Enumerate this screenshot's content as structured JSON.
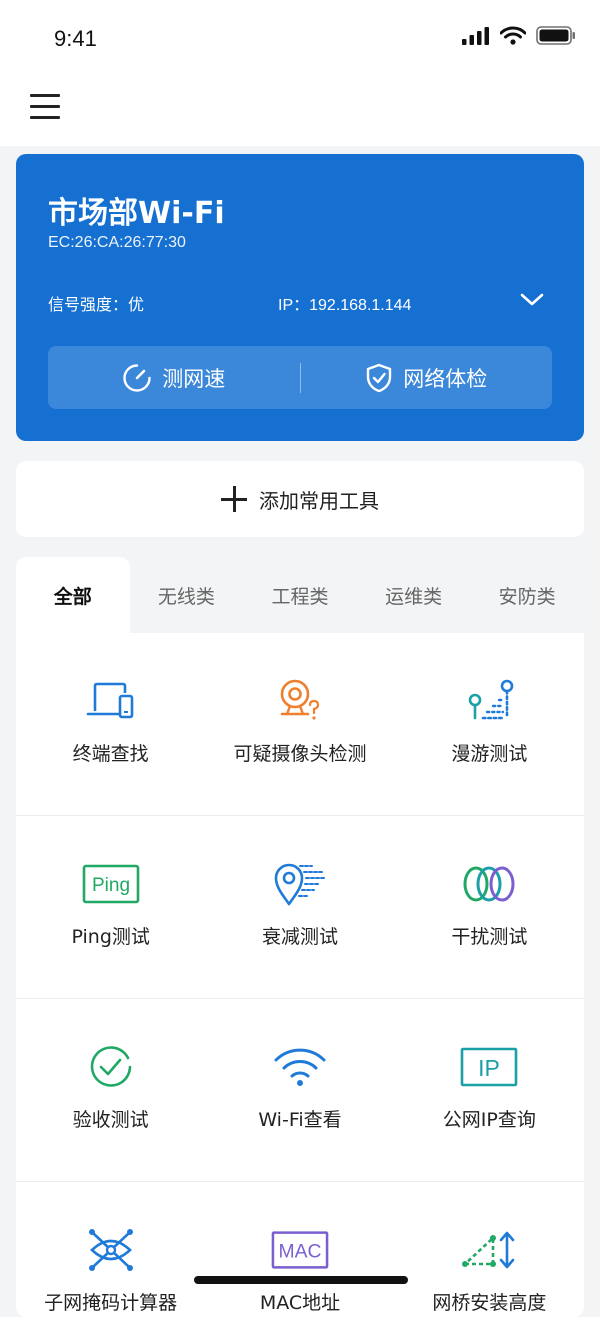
{
  "status_bar": {
    "time": "9:41"
  },
  "wifi": {
    "ssid": "市场部Wi-Fi",
    "mac": "EC:26:CA:26:77:30",
    "signal": "信号强度：优",
    "ip": "IP：192.168.1.144",
    "speed_test_label": "测网速",
    "network_check_label": "网络体检"
  },
  "add_tool_label": "添加常用工具",
  "tabs": [
    "全部",
    "无线类",
    "工程类",
    "运维类",
    "安防类"
  ],
  "tools": [
    {
      "label": "终端查找",
      "icon": "device-search-icon"
    },
    {
      "label": "可疑摄像头检测",
      "icon": "camera-detect-icon"
    },
    {
      "label": "漫游测试",
      "icon": "roaming-test-icon"
    },
    {
      "label": "Ping测试",
      "icon": "ping-icon",
      "icon_text": "Ping"
    },
    {
      "label": "衰减测试",
      "icon": "attenuation-icon"
    },
    {
      "label": "干扰测试",
      "icon": "interference-icon"
    },
    {
      "label": "验收测试",
      "icon": "acceptance-check-icon"
    },
    {
      "label": "Wi-Fi查看",
      "icon": "wifi-icon"
    },
    {
      "label": "公网IP查询",
      "icon": "public-ip-icon",
      "icon_text": "IP"
    },
    {
      "label": "子网掩码计算器",
      "icon": "subnet-calculator-icon"
    },
    {
      "label": "MAC地址",
      "icon": "mac-address-icon",
      "icon_text": "MAC"
    },
    {
      "label": "网桥安装高度",
      "icon": "bridge-height-icon"
    }
  ],
  "colors": {
    "card_blue": "#1670d2",
    "icon_blue": "#1f7ad8",
    "icon_orange": "#f07f2d",
    "icon_green": "#21a865",
    "icon_teal": "#1aa0a6",
    "icon_purple": "#7b5fd0"
  }
}
